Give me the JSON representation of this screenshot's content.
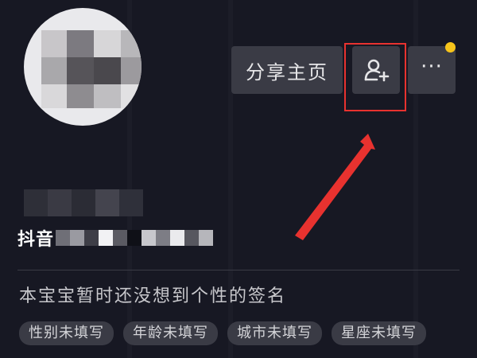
{
  "header": {
    "share_label": "分享主页",
    "add_friend_icon": "add-friend-icon",
    "more_label": "···",
    "notification_color": "#f7c41b"
  },
  "profile": {
    "douyin_id_label": "抖音"
  },
  "signature": "本宝宝暂时还没想到个性的签名",
  "tags": [
    "性别未填写",
    "年龄未填写",
    "城市未填写",
    "星座未填写"
  ],
  "annotation": {
    "color": "#e8322f",
    "icon": "red-arrow-pointer"
  }
}
